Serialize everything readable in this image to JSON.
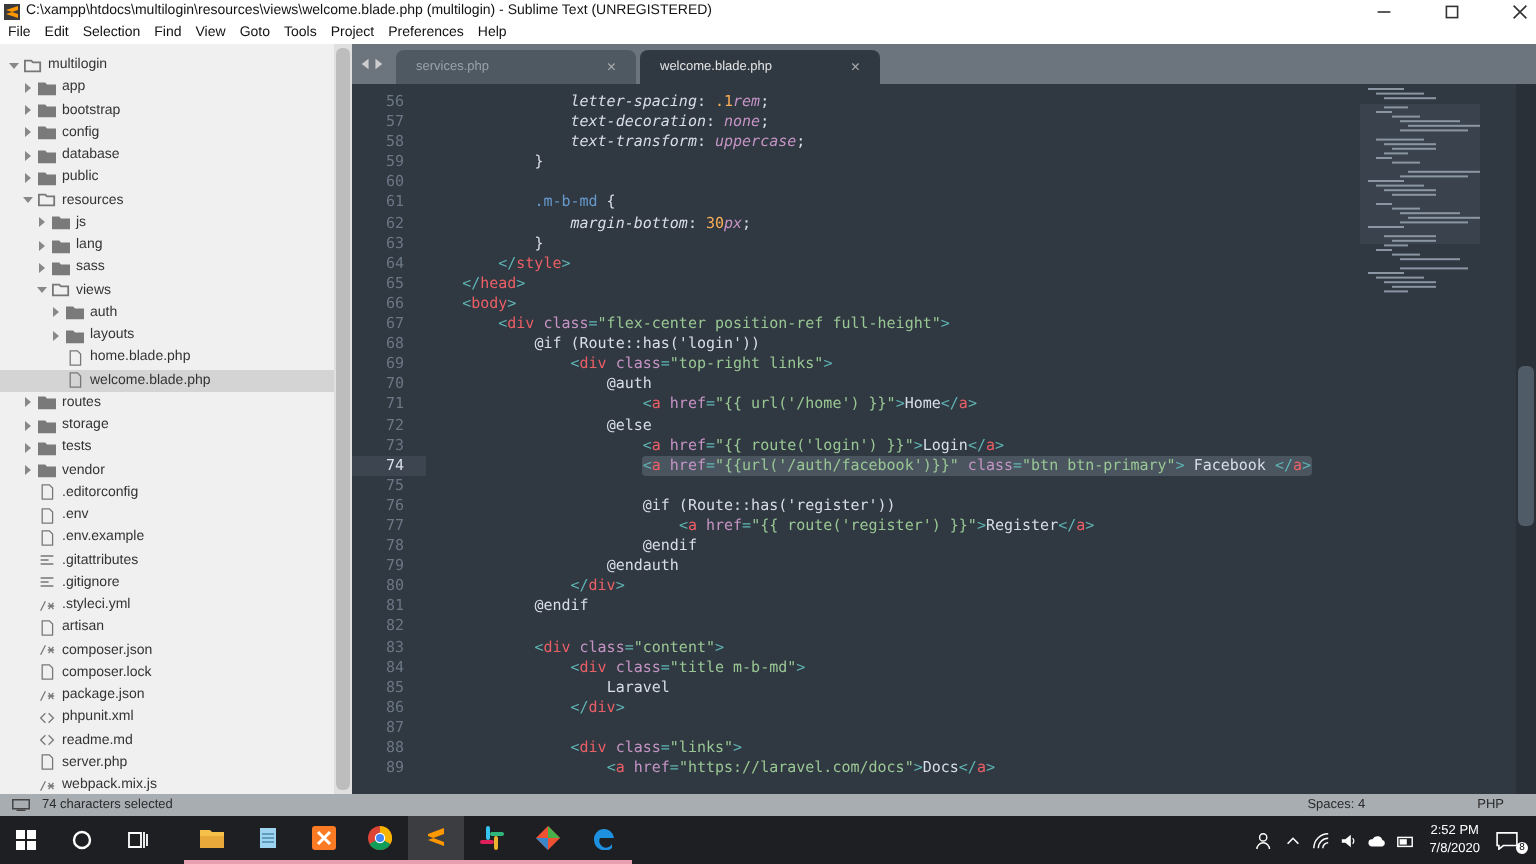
{
  "window": {
    "title": "C:\\xampp\\htdocs\\multilogin\\resources\\views\\welcome.blade.php (multilogin) - Sublime Text (UNREGISTERED)"
  },
  "menu": [
    "File",
    "Edit",
    "Selection",
    "Find",
    "View",
    "Goto",
    "Tools",
    "Project",
    "Preferences",
    "Help"
  ],
  "sidebar": {
    "tree": [
      {
        "label": "multilogin",
        "kind": "folder",
        "expanded": true,
        "selected": false,
        "children": [
          {
            "label": "app",
            "kind": "folder",
            "expanded": false,
            "selected": false
          },
          {
            "label": "bootstrap",
            "kind": "folder",
            "expanded": false,
            "selected": false
          },
          {
            "label": "config",
            "kind": "folder",
            "expanded": false,
            "selected": false
          },
          {
            "label": "database",
            "kind": "folder",
            "expanded": false,
            "selected": false
          },
          {
            "label": "public",
            "kind": "folder",
            "expanded": false,
            "selected": false
          },
          {
            "label": "resources",
            "kind": "folder",
            "expanded": true,
            "selected": false,
            "children": [
              {
                "label": "js",
                "kind": "folder",
                "expanded": false,
                "selected": false
              },
              {
                "label": "lang",
                "kind": "folder",
                "expanded": false,
                "selected": false
              },
              {
                "label": "sass",
                "kind": "folder",
                "expanded": false,
                "selected": false
              },
              {
                "label": "views",
                "kind": "folder",
                "expanded": true,
                "selected": false,
                "children": [
                  {
                    "label": "auth",
                    "kind": "folder",
                    "expanded": false,
                    "selected": false
                  },
                  {
                    "label": "layouts",
                    "kind": "folder",
                    "expanded": false,
                    "selected": false
                  },
                  {
                    "label": "home.blade.php",
                    "kind": "file",
                    "selected": false
                  },
                  {
                    "label": "welcome.blade.php",
                    "kind": "file",
                    "selected": true
                  }
                ]
              }
            ]
          },
          {
            "label": "routes",
            "kind": "folder",
            "expanded": false,
            "selected": false
          },
          {
            "label": "storage",
            "kind": "folder",
            "expanded": false,
            "selected": false
          },
          {
            "label": "tests",
            "kind": "folder",
            "expanded": false,
            "selected": false
          },
          {
            "label": "vendor",
            "kind": "folder",
            "expanded": false,
            "selected": false
          },
          {
            "label": ".editorconfig",
            "kind": "file",
            "selected": false
          },
          {
            "label": ".env",
            "kind": "file",
            "selected": false
          },
          {
            "label": ".env.example",
            "kind": "file",
            "selected": false
          },
          {
            "label": ".gitattributes",
            "kind": "lines-file",
            "selected": false
          },
          {
            "label": ".gitignore",
            "kind": "lines-file",
            "selected": false
          },
          {
            "label": ".styleci.yml",
            "kind": "comment-file",
            "selected": false
          },
          {
            "label": "artisan",
            "kind": "file",
            "selected": false
          },
          {
            "label": "composer.json",
            "kind": "comment-file",
            "selected": false
          },
          {
            "label": "composer.lock",
            "kind": "file",
            "selected": false
          },
          {
            "label": "package.json",
            "kind": "comment-file",
            "selected": false
          },
          {
            "label": "phpunit.xml",
            "kind": "markup-file",
            "selected": false
          },
          {
            "label": "readme.md",
            "kind": "markup-file",
            "selected": false
          },
          {
            "label": "server.php",
            "kind": "file",
            "selected": false
          },
          {
            "label": "webpack.mix.js",
            "kind": "comment-file",
            "selected": false
          }
        ]
      }
    ]
  },
  "tabs": [
    {
      "label": "services.php",
      "selected": false,
      "close": "×"
    },
    {
      "label": "welcome.blade.php",
      "selected": true,
      "close": "×"
    }
  ],
  "code": [
    {
      "number": "56",
      "selected": false,
      "tokens": [
        {
          "kind": "property",
          "text": "                letter-spacing"
        },
        {
          "kind": "plain",
          "text": ": "
        },
        {
          "kind": "number",
          "text": ".1"
        },
        {
          "kind": "value",
          "text": "rem"
        },
        {
          "kind": "plain",
          "text": ";"
        }
      ]
    },
    {
      "number": "57",
      "selected": false,
      "tokens": [
        {
          "kind": "property",
          "text": "                text-decoration"
        },
        {
          "kind": "plain",
          "text": ": "
        },
        {
          "kind": "value",
          "text": "none"
        },
        {
          "kind": "plain",
          "text": ";"
        }
      ]
    },
    {
      "number": "58",
      "selected": false,
      "tokens": [
        {
          "kind": "property",
          "text": "                text-transform"
        },
        {
          "kind": "plain",
          "text": ": "
        },
        {
          "kind": "value",
          "text": "uppercase"
        },
        {
          "kind": "plain",
          "text": ";"
        }
      ]
    },
    {
      "number": "59",
      "selected": false,
      "tokens": [
        {
          "kind": "plain",
          "text": "            }"
        }
      ]
    },
    {
      "number": "60",
      "selected": false
    },
    {
      "number": "61",
      "selected": false,
      "tokens": [
        {
          "kind": "selector",
          "text": "            .m-b-md"
        },
        {
          "kind": "plain",
          "text": " {"
        }
      ]
    },
    {
      "number": "62",
      "selected": false,
      "tokens": [
        {
          "kind": "property",
          "text": "                margin-bottom"
        },
        {
          "kind": "plain",
          "text": ": "
        },
        {
          "kind": "number",
          "text": "30"
        },
        {
          "kind": "value",
          "text": "px"
        },
        {
          "kind": "plain",
          "text": ";"
        }
      ]
    },
    {
      "number": "63",
      "selected": false,
      "tokens": [
        {
          "kind": "plain",
          "text": "            }"
        }
      ]
    },
    {
      "number": "64",
      "selected": false,
      "tokens": [
        {
          "kind": "punct",
          "text": "        </"
        },
        {
          "kind": "tag",
          "text": "style"
        },
        {
          "kind": "punct",
          "text": ">"
        }
      ]
    },
    {
      "number": "65",
      "selected": false,
      "tokens": [
        {
          "kind": "punct",
          "text": "    </"
        },
        {
          "kind": "tag",
          "text": "head"
        },
        {
          "kind": "punct",
          "text": ">"
        }
      ]
    },
    {
      "number": "66",
      "selected": false,
      "tokens": [
        {
          "kind": "punct",
          "text": "    <"
        },
        {
          "kind": "tag",
          "text": "body"
        },
        {
          "kind": "punct",
          "text": ">"
        }
      ]
    },
    {
      "number": "67",
      "selected": false,
      "tokens": [
        {
          "kind": "punct",
          "text": "        <"
        },
        {
          "kind": "tag",
          "text": "div"
        },
        {
          "kind": "attr",
          "text": " class"
        },
        {
          "kind": "punct",
          "text": "="
        },
        {
          "kind": "string",
          "text": "\"flex-center position-ref full-height\""
        },
        {
          "kind": "punct",
          "text": ">"
        }
      ]
    },
    {
      "number": "68",
      "selected": false,
      "tokens": [
        {
          "kind": "plain",
          "text": "            @if (Route::has('login'))"
        }
      ]
    },
    {
      "number": "69",
      "selected": false,
      "tokens": [
        {
          "kind": "punct",
          "text": "                <"
        },
        {
          "kind": "tag",
          "text": "div"
        },
        {
          "kind": "attr",
          "text": " class"
        },
        {
          "kind": "punct",
          "text": "="
        },
        {
          "kind": "string",
          "text": "\"top-right links\""
        },
        {
          "kind": "punct",
          "text": ">"
        }
      ]
    },
    {
      "number": "70",
      "selected": false,
      "tokens": [
        {
          "kind": "plain",
          "text": "                    @auth"
        }
      ]
    },
    {
      "number": "71",
      "selected": false,
      "tokens": [
        {
          "kind": "punct",
          "text": "                        <"
        },
        {
          "kind": "tag",
          "text": "a"
        },
        {
          "kind": "attr",
          "text": " href"
        },
        {
          "kind": "punct",
          "text": "="
        },
        {
          "kind": "string",
          "text": "\"{{ url('/home') }}\""
        },
        {
          "kind": "punct",
          "text": ">"
        },
        {
          "kind": "plain",
          "text": "Home"
        },
        {
          "kind": "punct",
          "text": "</"
        },
        {
          "kind": "tag",
          "text": "a"
        },
        {
          "kind": "punct",
          "text": ">"
        }
      ]
    },
    {
      "number": "72",
      "selected": false,
      "tokens": [
        {
          "kind": "plain",
          "text": "                    @else"
        }
      ]
    },
    {
      "number": "73",
      "selected": false,
      "tokens": [
        {
          "kind": "punct",
          "text": "                        <"
        },
        {
          "kind": "tag",
          "text": "a"
        },
        {
          "kind": "attr",
          "text": " href"
        },
        {
          "kind": "punct",
          "text": "="
        },
        {
          "kind": "string",
          "text": "\"{{ route('login') }}\""
        },
        {
          "kind": "punct",
          "text": ">"
        },
        {
          "kind": "plain",
          "text": "Login"
        },
        {
          "kind": "punct",
          "text": "</"
        },
        {
          "kind": "tag",
          "text": "a"
        },
        {
          "kind": "punct",
          "text": ">"
        }
      ]
    },
    {
      "number": "74",
      "selected": true,
      "tokens": [
        {
          "kind": "punct",
          "text": "                        <"
        },
        {
          "kind": "tag",
          "text": "a"
        },
        {
          "kind": "attr",
          "text": " href"
        },
        {
          "kind": "punct",
          "text": "="
        },
        {
          "kind": "string",
          "text": "\"{{url('/auth/facebook')}}\""
        },
        {
          "kind": "attr",
          "text": " class"
        },
        {
          "kind": "punct",
          "text": "="
        },
        {
          "kind": "string",
          "text": "\"btn btn-primary\""
        },
        {
          "kind": "punct",
          "text": ">"
        },
        {
          "kind": "plain",
          "text": " Facebook "
        },
        {
          "kind": "punct",
          "text": "</"
        },
        {
          "kind": "tag",
          "text": "a"
        },
        {
          "kind": "punct",
          "text": ">"
        }
      ]
    },
    {
      "number": "75",
      "selected": false
    },
    {
      "number": "76",
      "selected": false,
      "tokens": [
        {
          "kind": "plain",
          "text": "                        @if (Route::has('register'))"
        }
      ]
    },
    {
      "number": "77",
      "selected": false,
      "tokens": [
        {
          "kind": "punct",
          "text": "                            <"
        },
        {
          "kind": "tag",
          "text": "a"
        },
        {
          "kind": "attr",
          "text": " href"
        },
        {
          "kind": "punct",
          "text": "="
        },
        {
          "kind": "string",
          "text": "\"{{ route('register') }}\""
        },
        {
          "kind": "punct",
          "text": ">"
        },
        {
          "kind": "plain",
          "text": "Register"
        },
        {
          "kind": "punct",
          "text": "</"
        },
        {
          "kind": "tag",
          "text": "a"
        },
        {
          "kind": "punct",
          "text": ">"
        }
      ]
    },
    {
      "number": "78",
      "selected": false,
      "tokens": [
        {
          "kind": "plain",
          "text": "                        @endif"
        }
      ]
    },
    {
      "number": "79",
      "selected": false,
      "tokens": [
        {
          "kind": "plain",
          "text": "                    @endauth"
        }
      ]
    },
    {
      "number": "80",
      "selected": false,
      "tokens": [
        {
          "kind": "punct",
          "text": "                </"
        },
        {
          "kind": "tag",
          "text": "div"
        },
        {
          "kind": "punct",
          "text": ">"
        }
      ]
    },
    {
      "number": "81",
      "selected": false,
      "tokens": [
        {
          "kind": "plain",
          "text": "            @endif"
        }
      ]
    },
    {
      "number": "82",
      "selected": false
    },
    {
      "number": "83",
      "selected": false,
      "tokens": [
        {
          "kind": "punct",
          "text": "            <"
        },
        {
          "kind": "tag",
          "text": "div"
        },
        {
          "kind": "attr",
          "text": " class"
        },
        {
          "kind": "punct",
          "text": "="
        },
        {
          "kind": "string",
          "text": "\"content\""
        },
        {
          "kind": "punct",
          "text": ">"
        }
      ]
    },
    {
      "number": "84",
      "selected": false,
      "tokens": [
        {
          "kind": "punct",
          "text": "                <"
        },
        {
          "kind": "tag",
          "text": "div"
        },
        {
          "kind": "attr",
          "text": " class"
        },
        {
          "kind": "punct",
          "text": "="
        },
        {
          "kind": "string",
          "text": "\"title m-b-md\""
        },
        {
          "kind": "punct",
          "text": ">"
        }
      ]
    },
    {
      "number": "85",
      "selected": false,
      "tokens": [
        {
          "kind": "plain",
          "text": "                    Laravel"
        }
      ]
    },
    {
      "number": "86",
      "selected": false,
      "tokens": [
        {
          "kind": "punct",
          "text": "                </"
        },
        {
          "kind": "tag",
          "text": "div"
        },
        {
          "kind": "punct",
          "text": ">"
        }
      ]
    },
    {
      "number": "87",
      "selected": false
    },
    {
      "number": "88",
      "selected": false,
      "tokens": [
        {
          "kind": "punct",
          "text": "                <"
        },
        {
          "kind": "tag",
          "text": "div"
        },
        {
          "kind": "attr",
          "text": " class"
        },
        {
          "kind": "punct",
          "text": "="
        },
        {
          "kind": "string",
          "text": "\"links\""
        },
        {
          "kind": "punct",
          "text": ">"
        }
      ]
    },
    {
      "number": "89",
      "selected": false,
      "tokens": [
        {
          "kind": "punct",
          "text": "                    <"
        },
        {
          "kind": "tag",
          "text": "a"
        },
        {
          "kind": "attr",
          "text": " href"
        },
        {
          "kind": "punct",
          "text": "="
        },
        {
          "kind": "string",
          "text": "\"https://laravel.com/docs\""
        },
        {
          "kind": "punct",
          "text": ">"
        },
        {
          "kind": "plain",
          "text": "Docs"
        },
        {
          "kind": "punct",
          "text": "</"
        },
        {
          "kind": "tag",
          "text": "a"
        },
        {
          "kind": "punct",
          "text": ">"
        }
      ]
    }
  ],
  "status_bar": {
    "selection": "74 characters selected",
    "indentation": "Spaces: 4",
    "syntax": "PHP"
  },
  "taskbar": {
    "apps": [
      {
        "kind": "folder",
        "running": true,
        "selected": false
      },
      {
        "kind": "notepad",
        "running": true,
        "selected": false
      },
      {
        "kind": "cross",
        "running": true,
        "selected": false
      },
      {
        "kind": "wheel",
        "running": true,
        "selected": false
      },
      {
        "kind": "stripes",
        "running": true,
        "selected": true
      },
      {
        "kind": "hash",
        "running": true,
        "selected": false
      },
      {
        "kind": "diamond",
        "running": true,
        "selected": false
      },
      {
        "kind": "swirl",
        "running": true,
        "selected": false
      }
    ],
    "time": "2:52 PM",
    "date": "7/8/2020",
    "notification_count": "8"
  }
}
